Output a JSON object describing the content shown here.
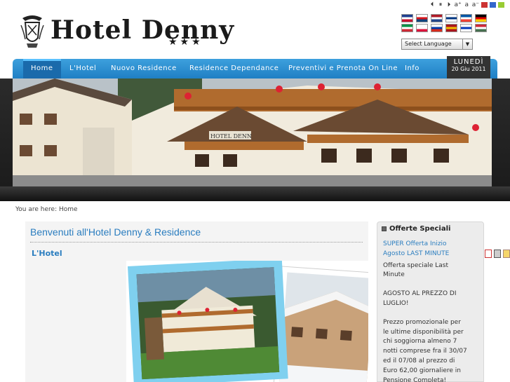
{
  "header": {
    "hotel_name": "Hotel Denny",
    "stars": "★★★"
  },
  "accessibility": {
    "controls": [
      "a",
      "a",
      "a",
      "a"
    ]
  },
  "language": {
    "flags": [
      {
        "name": "uk-flag-icon",
        "colors": [
          "#1f3f8f",
          "#ffffff",
          "#c8102e"
        ]
      },
      {
        "name": "czech-flag-icon",
        "colors": [
          "#ffffff",
          "#d7141a",
          "#11457e"
        ]
      },
      {
        "name": "netherlands-flag-icon",
        "colors": [
          "#ae1c28",
          "#ffffff",
          "#21468b"
        ]
      },
      {
        "name": "finland-flag-icon",
        "colors": [
          "#ffffff",
          "#003580",
          "#ffffff"
        ]
      },
      {
        "name": "france-flag-icon",
        "colors": [
          "#0055a4",
          "#ffffff",
          "#ef4135"
        ]
      },
      {
        "name": "germany-flag-icon",
        "colors": [
          "#000000",
          "#dd0000",
          "#ffce00"
        ]
      },
      {
        "name": "italy-flag-icon",
        "colors": [
          "#009246",
          "#ffffff",
          "#ce2b37"
        ]
      },
      {
        "name": "poland-flag-icon",
        "colors": [
          "#ffffff",
          "#ffffff",
          "#dc143c"
        ]
      },
      {
        "name": "russia-flag-icon",
        "colors": [
          "#ffffff",
          "#0039a6",
          "#d52b1e"
        ]
      },
      {
        "name": "spain-flag-icon",
        "colors": [
          "#aa151b",
          "#f1bf00",
          "#aa151b"
        ]
      },
      {
        "name": "israel-flag-icon",
        "colors": [
          "#ffffff",
          "#0038b8",
          "#ffffff"
        ]
      },
      {
        "name": "hungary-flag-icon",
        "colors": [
          "#ce2939",
          "#ffffff",
          "#477050"
        ]
      }
    ],
    "select_value": "Select Language"
  },
  "nav": {
    "items": [
      {
        "label": "Home",
        "active": true
      },
      {
        "label": "L'Hotel",
        "active": false
      },
      {
        "label": "Nuovo Residence",
        "active": false
      },
      {
        "label": "Residence Dependance",
        "active": false
      },
      {
        "label": "Preventivi e Prenota On Line",
        "active": false
      },
      {
        "label": "Info",
        "active": false
      }
    ],
    "date_day": "LUNEDÌ",
    "date_full": "20 Giu 2011"
  },
  "breadcrumb": {
    "prefix": "You are here:",
    "current": "Home"
  },
  "main": {
    "title": "Benvenuti all'Hotel Denny & Residence",
    "section": "L'Hotel"
  },
  "sidebar": {
    "title": "Offerte Speciali",
    "link_line1": "SUPER Offerta Inizio",
    "link_line2": "Agosto LAST MINUTE",
    "text_lines_a": [
      "Offerta speciale Last",
      "Minute"
    ],
    "text_lines_b": [
      "AGOSTO AL PREZZO DI",
      "LUGLIO!"
    ],
    "text_lines_c": [
      "Prezzo promozionale per",
      "le ultime disponibilità per",
      "chi soggiorna almeno 7",
      "notti comprese fra il 30/07",
      "ed il 07/08 al prezzo di",
      "Euro 62,00 giornaliere in",
      "Pensione Completa!"
    ]
  },
  "colors": {
    "nav_blue": "#2a8ed3",
    "link_blue": "#2a7dbf"
  }
}
